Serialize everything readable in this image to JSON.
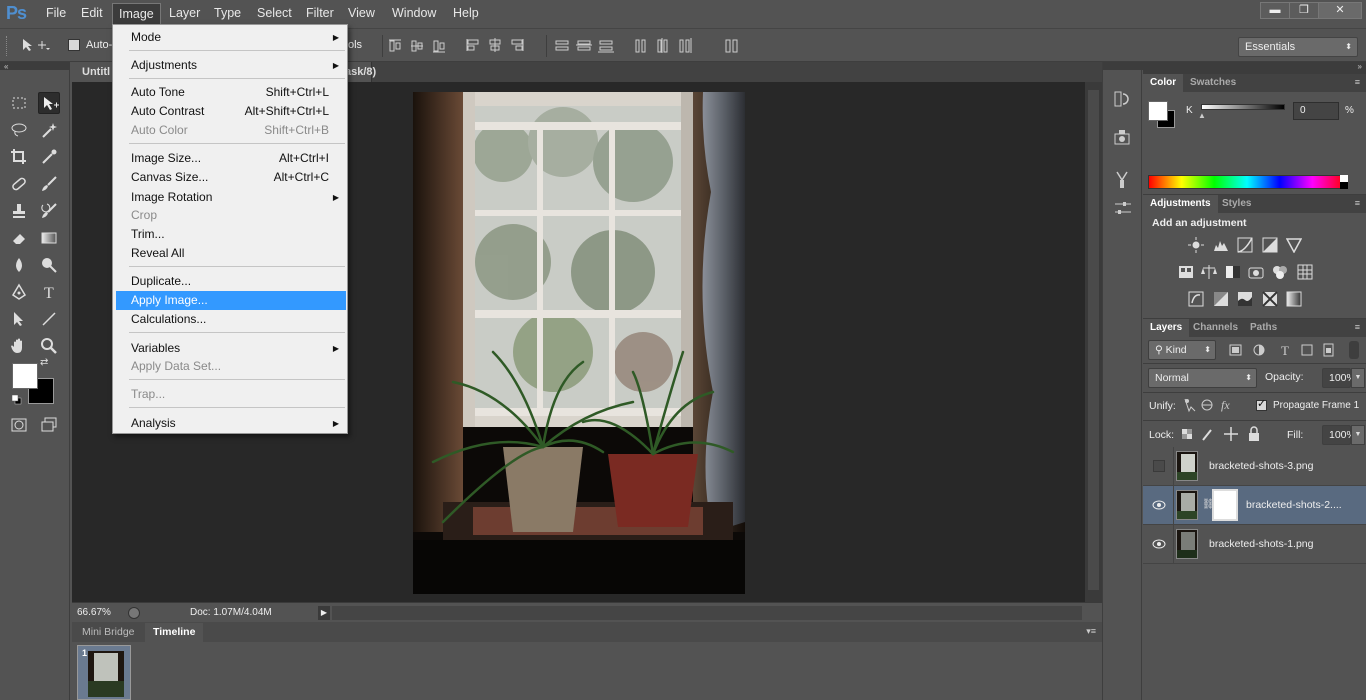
{
  "app": {
    "logo": "Ps"
  },
  "menubar": {
    "items": [
      "File",
      "Edit",
      "Image",
      "Layer",
      "Type",
      "Select",
      "Filter",
      "View",
      "Window",
      "Help"
    ],
    "active": "Image"
  },
  "window_controls": {
    "minimize": "▬",
    "restore": "❐",
    "close": "✕"
  },
  "options_bar": {
    "auto_select_label": "Auto-",
    "controls_fragment": "ols",
    "workspace": "Essentials"
  },
  "document": {
    "tab_title_left": "Untitl",
    "tab_title_right": "ask/8) *",
    "zoom": "66.67%",
    "doc_info": "Doc: 1.07M/4.04M"
  },
  "bottom_panel": {
    "tabs": [
      "Mini Bridge",
      "Timeline"
    ],
    "active_tab": "Timeline",
    "frame_number": "1"
  },
  "image_menu": {
    "items": [
      {
        "label": "Mode",
        "shortcut": "",
        "submenu": true,
        "disabled": false
      },
      {
        "sep": true
      },
      {
        "label": "Adjustments",
        "shortcut": "",
        "submenu": true,
        "disabled": false
      },
      {
        "sep": true
      },
      {
        "label": "Auto Tone",
        "shortcut": "Shift+Ctrl+L",
        "disabled": false
      },
      {
        "label": "Auto Contrast",
        "shortcut": "Alt+Shift+Ctrl+L",
        "disabled": false
      },
      {
        "label": "Auto Color",
        "shortcut": "Shift+Ctrl+B",
        "disabled": true
      },
      {
        "sep": true
      },
      {
        "label": "Image Size...",
        "shortcut": "Alt+Ctrl+I",
        "disabled": false
      },
      {
        "label": "Canvas Size...",
        "shortcut": "Alt+Ctrl+C",
        "disabled": false
      },
      {
        "label": "Image Rotation",
        "shortcut": "",
        "submenu": true,
        "disabled": false
      },
      {
        "label": "Crop",
        "shortcut": "",
        "disabled": true
      },
      {
        "label": "Trim...",
        "shortcut": "",
        "disabled": false
      },
      {
        "label": "Reveal All",
        "shortcut": "",
        "disabled": false
      },
      {
        "sep": true
      },
      {
        "label": "Duplicate...",
        "shortcut": "",
        "disabled": false
      },
      {
        "label": "Apply Image...",
        "shortcut": "",
        "disabled": false,
        "highlighted": true
      },
      {
        "label": "Calculations...",
        "shortcut": "",
        "disabled": false
      },
      {
        "sep": true
      },
      {
        "label": "Variables",
        "shortcut": "",
        "submenu": true,
        "disabled": false
      },
      {
        "label": "Apply Data Set...",
        "shortcut": "",
        "disabled": true
      },
      {
        "sep": true
      },
      {
        "label": "Trap...",
        "shortcut": "",
        "disabled": true
      },
      {
        "sep": true
      },
      {
        "label": "Analysis",
        "shortcut": "",
        "submenu": true,
        "disabled": false
      }
    ]
  },
  "color_panel": {
    "tabs": [
      "Color",
      "Swatches"
    ],
    "active_tab": "Color",
    "channel_label": "K",
    "value": "0",
    "unit": "%"
  },
  "adjustments_panel": {
    "tabs": [
      "Adjustments",
      "Styles"
    ],
    "active_tab": "Adjustments",
    "heading": "Add an adjustment"
  },
  "layers_panel": {
    "tabs": [
      "Layers",
      "Channels",
      "Paths"
    ],
    "active_tab": "Layers",
    "filter_kind": "Kind",
    "blend_mode": "Normal",
    "opacity_label": "Opacity:",
    "opacity_value": "100%",
    "unify_label": "Unify:",
    "propagate_label": "Propagate Frame 1",
    "lock_label": "Lock:",
    "fill_label": "Fill:",
    "fill_value": "100%",
    "layers": [
      {
        "name": "bracketed-shots-3.png",
        "visible": false,
        "selected": false,
        "mask": false
      },
      {
        "name": "bracketed-shots-2....",
        "visible": true,
        "selected": true,
        "mask": true
      },
      {
        "name": "bracketed-shots-1.png",
        "visible": true,
        "selected": false,
        "mask": false
      }
    ]
  },
  "colors": {
    "menu_highlight": "#3399ff",
    "selected_layer": "#596a80",
    "logo_blue": "#4f8fd0"
  }
}
